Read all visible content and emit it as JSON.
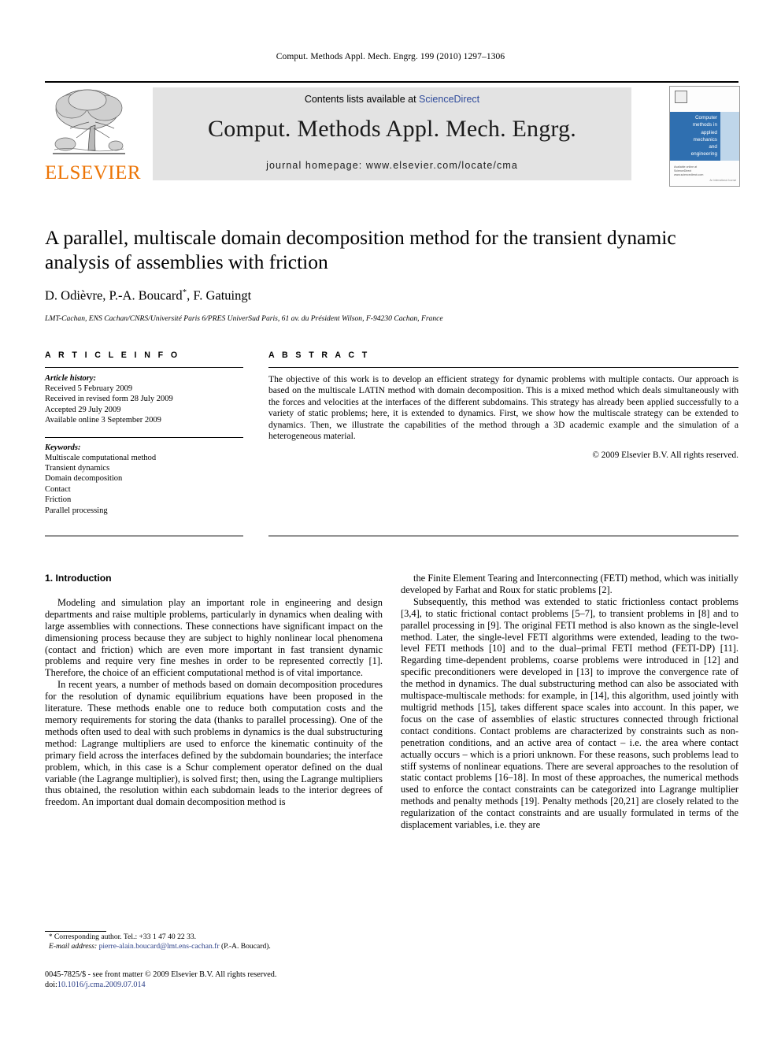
{
  "running_head": "Comput. Methods Appl. Mech. Engrg. 199 (2010) 1297–1306",
  "masthead": {
    "publisher_name": "ELSEVIER",
    "contents_prefix": "Contents lists available at ",
    "contents_link": "ScienceDirect",
    "journal_title": "Comput. Methods Appl. Mech. Engrg.",
    "journal_homepage": "journal homepage: www.elsevier.com/locate/cma",
    "cover": {
      "line1": "Computer",
      "line2": "methods in",
      "line3": "applied",
      "line4": "mechanics",
      "line5": "and",
      "line6": "engineering",
      "foot_top": "Available online at",
      "foot_brand": "ScienceDirect",
      "foot_url": "www.sciencedirect.com",
      "foot_right": "An International Journal"
    }
  },
  "article": {
    "title": "A parallel, multiscale domain decomposition method for the transient dynamic analysis of assemblies with friction",
    "authors": "D. Odièvre, P.-A. Boucard",
    "authors_star": "*",
    "authors_tail": ", F. Gatuingt",
    "affiliation": "LMT-Cachan, ENS Cachan/CNRS/Université Paris 6/PRES UniverSud Paris, 61 av. du Président Wilson, F-94230 Cachan, France"
  },
  "article_info": {
    "heading": "A R T I C L E   I N F O",
    "history_label": "Article history:",
    "history": [
      "Received 5 February 2009",
      "Received in revised form 28 July 2009",
      "Accepted 29 July 2009",
      "Available online 3 September 2009"
    ],
    "keywords_label": "Keywords:",
    "keywords": [
      "Multiscale computational method",
      "Transient dynamics",
      "Domain decomposition",
      "Contact",
      "Friction",
      "Parallel processing"
    ]
  },
  "abstract": {
    "heading": "A B S T R A C T",
    "text": "The objective of this work is to develop an efficient strategy for dynamic problems with multiple contacts. Our approach is based on the multiscale LATIN method with domain decomposition. This is a mixed method which deals simultaneously with the forces and velocities at the interfaces of the different subdomains. This strategy has already been applied successfully to a variety of static problems; here, it is extended to dynamics. First, we show how the multiscale strategy can be extended to dynamics. Then, we illustrate the capabilities of the method through a 3D academic example and the simulation of a heterogeneous material.",
    "copyright": "© 2009 Elsevier B.V. All rights reserved."
  },
  "body": {
    "section_number_title": "1. Introduction",
    "left_paragraphs": [
      "Modeling and simulation play an important role in engineering and design departments and raise multiple problems, particularly in dynamics when dealing with large assemblies with connections. These connections have significant impact on the dimensioning process because they are subject to highly nonlinear local phenomena (contact and friction) which are even more important in fast transient dynamic problems and require very fine meshes in order to be represented correctly [1]. Therefore, the choice of an efficient computational method is of vital importance.",
      "In recent years, a number of methods based on domain decomposition procedures for the resolution of dynamic equilibrium equations have been proposed in the literature. These methods enable one to reduce both computation costs and the memory requirements for storing the data (thanks to parallel processing). One of the methods often used to deal with such problems in dynamics is the dual substructuring method: Lagrange multipliers are used to enforce the kinematic continuity of the primary field across the interfaces defined by the subdomain boundaries; the interface problem, which, in this case is a Schur complement operator defined on the dual variable (the Lagrange multiplier), is solved first; then, using the Lagrange multipliers thus obtained, the resolution within each subdomain leads to the interior degrees of freedom. An important dual domain decomposition method is"
    ],
    "right_paragraphs": [
      "the Finite Element Tearing and Interconnecting (FETI) method, which was initially developed by Farhat and Roux for static problems [2].",
      "Subsequently, this method was extended to static frictionless contact problems [3,4], to static frictional contact problems [5–7], to transient problems in [8] and to parallel processing in [9]. The original FETI method is also known as the single-level method. Later, the single-level FETI algorithms were extended, leading to the two-level FETI methods [10] and to the dual–primal FETI method (FETI-DP) [11]. Regarding time-dependent problems, coarse problems were introduced in [12] and specific preconditioners were developed in [13] to improve the convergence rate of the method in dynamics. The dual substructuring method can also be associated with multispace-multiscale methods: for example, in [14], this algorithm, used jointly with multigrid methods [15], takes different space scales into account. In this paper, we focus on the case of assemblies of elastic structures connected through frictional contact conditions. Contact problems are characterized by constraints such as non-penetration conditions, and an active area of contact – i.e. the area where contact actually occurs – which is a priori unknown. For these reasons, such problems lead to stiff systems of nonlinear equations. There are several approaches to the resolution of static contact problems [16–18]. In most of these approaches, the numerical methods used to enforce the contact constraints can be categorized into Lagrange multiplier methods and penalty methods [19]. Penalty methods [20,21] are closely related to the regularization of the contact constraints and are usually formulated in terms of the displacement variables, i.e. they are"
    ]
  },
  "footnote": {
    "star": "*",
    "corresponding": "Corresponding author. Tel.: +33 1 47 40 22 33.",
    "email_label": "E-mail address:",
    "email": "pierre-alain.boucard@lmt.ens-cachan.fr",
    "email_owner": "(P.-A. Boucard)."
  },
  "bottom": {
    "issn_line": "0045-7825/$ - see front matter © 2009 Elsevier B.V. All rights reserved.",
    "doi_prefix": "doi:",
    "doi": "10.1016/j.cma.2009.07.014"
  },
  "colors": {
    "elsevier_orange": "#ec7405",
    "link_blue": "#2b3f87",
    "sciencedirect_blue": "#2f4b9b",
    "band_gray": "#e3e3e3",
    "cover_blue": "#2f6fb0"
  }
}
